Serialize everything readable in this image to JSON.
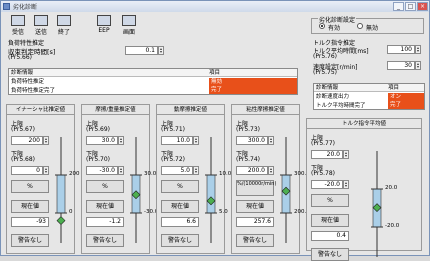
{
  "window": {
    "title": "劣化診断"
  },
  "toolbar": {
    "items": [
      {
        "label": "受信",
        "icon": "receive-icon"
      },
      {
        "label": "送信",
        "icon": "send-icon"
      },
      {
        "label": "終了",
        "icon": "exit-icon"
      },
      {
        "label": "EEP",
        "icon": "eep-icon"
      },
      {
        "label": "画面",
        "icon": "screen-icon"
      }
    ]
  },
  "diag_setting": {
    "title": "劣化診断設定",
    "enabled": "有効",
    "disabled": "無効",
    "selected": "enabled"
  },
  "load_estimation": {
    "title": "負荷特性推定",
    "conv_time_label": "収束判定時間[s]",
    "conv_time_param": "(Pr5.66)",
    "conv_time_value": "0.1",
    "table": {
      "header_left": "診断情報",
      "header_right": "項目",
      "rows": [
        {
          "label": "負荷特性推定",
          "value": "無効",
          "color": "#e8501a"
        },
        {
          "label": "負荷特性推定完了",
          "value": "完了",
          "color": "#e8501a"
        }
      ]
    }
  },
  "torque_estimation": {
    "title": "トルク指令推定",
    "avg_time_label": "トルク平均時間[ms]",
    "avg_time_param": "(Pr5.76)",
    "avg_time_value": "100",
    "speed_label": "速度設定[r/min]",
    "speed_param": "(Pr5.75)",
    "speed_value": "30",
    "table": {
      "header_left": "診断情報",
      "header_right": "項目",
      "rows": [
        {
          "label": "診断速度出力",
          "value": "オン",
          "color": "#e8501a"
        },
        {
          "label": "トルク平均時間完了",
          "value": "完了",
          "color": "#e8501a"
        }
      ]
    }
  },
  "panels": [
    {
      "title": "イナーシャ比推定値",
      "upper_label": "上限",
      "upper_param": "(Pr5.67)",
      "upper_value": "200",
      "lower_label": "下限",
      "lower_param": "(Pr5.68)",
      "lower_value": "0",
      "unit": "%",
      "current_label": "現在値",
      "current_value": "-93",
      "warning": "警告なし",
      "gauge_top": "200",
      "gauge_bottom": "0",
      "gauge_min": 0,
      "gauge_max": 200
    },
    {
      "title": "摩擦/重量推定値",
      "upper_label": "上限",
      "upper_param": "(Pr5.69)",
      "upper_value": "30.0",
      "lower_label": "下限",
      "lower_param": "(Pr5.70)",
      "lower_value": "-30.0",
      "unit": "%",
      "current_label": "現在値",
      "current_value": "-1.2",
      "warning": "警告なし",
      "gauge_top": "30.0",
      "gauge_bottom": "-30.0",
      "gauge_min": -30,
      "gauge_max": 30
    },
    {
      "title": "動摩擦推定値",
      "upper_label": "上限",
      "upper_param": "(Pr5.71)",
      "upper_value": "10.0",
      "lower_label": "下限",
      "lower_param": "(Pr5.72)",
      "lower_value": "5.0",
      "unit": "%",
      "current_label": "現在値",
      "current_value": "6.6",
      "warning": "警告なし",
      "gauge_top": "10.0",
      "gauge_bottom": "5.0",
      "gauge_min": 5,
      "gauge_max": 10
    },
    {
      "title": "粘性摩擦推定値",
      "upper_label": "上限",
      "upper_param": "(Pr5.73)",
      "upper_value": "300.0",
      "lower_label": "下限",
      "lower_param": "(Pr5.74)",
      "lower_value": "200.0",
      "unit": "%/(10000r/min)",
      "current_label": "現在値",
      "current_value": "257.6",
      "warning": "警告なし",
      "gauge_top": "300.0",
      "gauge_bottom": "200.0",
      "gauge_min": 200,
      "gauge_max": 300
    },
    {
      "title": "トルク指令平均値",
      "upper_label": "上限",
      "upper_param": "(Pr5.77)",
      "upper_value": "20.0",
      "lower_label": "下限",
      "lower_param": "(Pr5.78)",
      "lower_value": "-20.0",
      "unit": "%",
      "current_label": "現在値",
      "current_value": "0.4",
      "warning": "警告なし",
      "gauge_top": "20.0",
      "gauge_bottom": "-20.0",
      "gauge_min": -20,
      "gauge_max": 20
    }
  ]
}
